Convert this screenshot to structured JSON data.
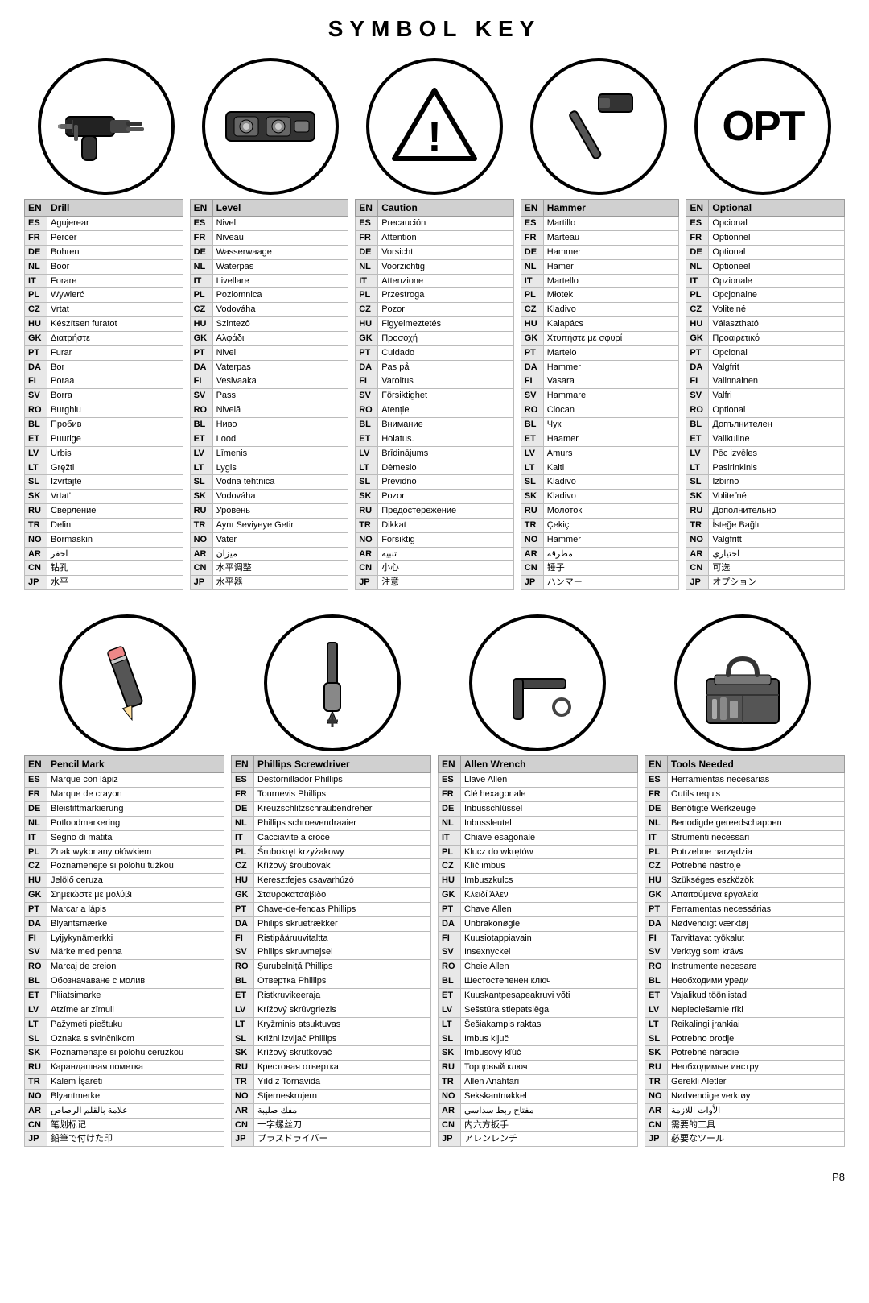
{
  "title": "SYMBOL KEY",
  "page": "P8",
  "top_icons": [
    {
      "name": "drill-icon",
      "label": "Drill"
    },
    {
      "name": "level-icon",
      "label": "Level"
    },
    {
      "name": "caution-icon",
      "label": "Caution"
    },
    {
      "name": "hammer-icon",
      "label": "Hammer"
    },
    {
      "name": "optional-icon",
      "label": "OPT"
    }
  ],
  "bottom_icons": [
    {
      "name": "pencil-icon",
      "label": "Pencil Mark"
    },
    {
      "name": "phillips-icon",
      "label": "Phillips Screwdriver"
    },
    {
      "name": "allen-icon",
      "label": "Allen Wrench"
    },
    {
      "name": "tools-icon",
      "label": "Tools Needed"
    }
  ],
  "tables": {
    "drill": {
      "header_code": "EN",
      "header_label": "Drill",
      "rows": [
        [
          "ES",
          "Agujerear"
        ],
        [
          "FR",
          "Percer"
        ],
        [
          "DE",
          "Bohren"
        ],
        [
          "NL",
          "Boor"
        ],
        [
          "IT",
          "Forare"
        ],
        [
          "PL",
          "Wywierć"
        ],
        [
          "CZ",
          "Vrtat"
        ],
        [
          "HU",
          "Készítsen furatot"
        ],
        [
          "GK",
          "Διατρήστε"
        ],
        [
          "PT",
          "Furar"
        ],
        [
          "DA",
          "Bor"
        ],
        [
          "FI",
          "Poraa"
        ],
        [
          "SV",
          "Borra"
        ],
        [
          "RO",
          "Burghiu"
        ],
        [
          "BL",
          "Пробив"
        ],
        [
          "ET",
          "Puurige"
        ],
        [
          "LV",
          "Urbis"
        ],
        [
          "LT",
          "Gręžti"
        ],
        [
          "SL",
          "Izvrtajte"
        ],
        [
          "SK",
          "Vrtat'"
        ],
        [
          "RU",
          "Сверление"
        ],
        [
          "TR",
          "Delin"
        ],
        [
          "NO",
          "Bormaskin"
        ],
        [
          "AR",
          "احفر"
        ],
        [
          "CN",
          "钻孔"
        ],
        [
          "JP",
          "水平"
        ]
      ]
    },
    "level": {
      "header_code": "EN",
      "header_label": "Level",
      "rows": [
        [
          "ES",
          "Nivel"
        ],
        [
          "FR",
          "Niveau"
        ],
        [
          "DE",
          "Wasserwaage"
        ],
        [
          "NL",
          "Waterpas"
        ],
        [
          "IT",
          "Livellare"
        ],
        [
          "PL",
          "Poziomnica"
        ],
        [
          "CZ",
          "Vodováha"
        ],
        [
          "HU",
          "Szintező"
        ],
        [
          "GK",
          "Αλφάδι"
        ],
        [
          "PT",
          "Nivel"
        ],
        [
          "DA",
          "Vaterpas"
        ],
        [
          "FI",
          "Vesivaaka"
        ],
        [
          "SV",
          "Pass"
        ],
        [
          "RO",
          "Nivelă"
        ],
        [
          "BL",
          "Ниво"
        ],
        [
          "ET",
          "Lood"
        ],
        [
          "LV",
          "Līmenis"
        ],
        [
          "LT",
          "Lygis"
        ],
        [
          "SL",
          "Vodna tehtnica"
        ],
        [
          "SK",
          "Vodováha"
        ],
        [
          "RU",
          "Уровень"
        ],
        [
          "TR",
          "Aynı Seviyeye Getir"
        ],
        [
          "NO",
          "Vater"
        ],
        [
          "AR",
          "ميزان"
        ],
        [
          "CN",
          "水平调整"
        ],
        [
          "JP",
          "水平器"
        ]
      ]
    },
    "caution": {
      "header_code": "EN",
      "header_label": "Caution",
      "rows": [
        [
          "ES",
          "Precaución"
        ],
        [
          "FR",
          "Attention"
        ],
        [
          "DE",
          "Vorsicht"
        ],
        [
          "NL",
          "Voorzichtig"
        ],
        [
          "IT",
          "Attenzione"
        ],
        [
          "PL",
          "Przestroga"
        ],
        [
          "CZ",
          "Pozor"
        ],
        [
          "HU",
          "Figyelmeztetés"
        ],
        [
          "GK",
          "Προσοχή"
        ],
        [
          "PT",
          "Cuidado"
        ],
        [
          "DA",
          "Pas på"
        ],
        [
          "FI",
          "Varoitus"
        ],
        [
          "SV",
          "Försiktighet"
        ],
        [
          "RO",
          "Atenție"
        ],
        [
          "BL",
          "Внимание"
        ],
        [
          "ET",
          "Hoiatus."
        ],
        [
          "LV",
          "Brīdinājums"
        ],
        [
          "LT",
          "Dėmesio"
        ],
        [
          "SL",
          "Previdno"
        ],
        [
          "SK",
          "Pozor"
        ],
        [
          "RU",
          "Предостережение"
        ],
        [
          "TR",
          "Dikkat"
        ],
        [
          "NO",
          "Forsiktig"
        ],
        [
          "AR",
          "تنبيه"
        ],
        [
          "CN",
          "小心"
        ],
        [
          "JP",
          "注意"
        ]
      ]
    },
    "hammer": {
      "header_code": "EN",
      "header_label": "Hammer",
      "rows": [
        [
          "ES",
          "Martillo"
        ],
        [
          "FR",
          "Marteau"
        ],
        [
          "DE",
          "Hammer"
        ],
        [
          "NL",
          "Hamer"
        ],
        [
          "IT",
          "Martello"
        ],
        [
          "PL",
          "Młotek"
        ],
        [
          "CZ",
          "Kladivo"
        ],
        [
          "HU",
          "Kalapács"
        ],
        [
          "GK",
          "Χτυπήστε με σφυρί"
        ],
        [
          "PT",
          "Martelo"
        ],
        [
          "DA",
          "Hammer"
        ],
        [
          "FI",
          "Vasara"
        ],
        [
          "SV",
          "Hammare"
        ],
        [
          "RO",
          "Ciocan"
        ],
        [
          "BL",
          "Чук"
        ],
        [
          "ET",
          "Haamer"
        ],
        [
          "LV",
          "Āmurs"
        ],
        [
          "LT",
          "Kalti"
        ],
        [
          "SL",
          "Kladivo"
        ],
        [
          "SK",
          "Kladivo"
        ],
        [
          "RU",
          "Молоток"
        ],
        [
          "TR",
          "Çekiç"
        ],
        [
          "NO",
          "Hammer"
        ],
        [
          "AR",
          "مطرقة"
        ],
        [
          "CN",
          "锤子"
        ],
        [
          "JP",
          "ハンマー"
        ]
      ]
    },
    "optional": {
      "header_code": "EN",
      "header_label": "Optional",
      "rows": [
        [
          "ES",
          "Opcional"
        ],
        [
          "FR",
          "Optionnel"
        ],
        [
          "DE",
          "Optional"
        ],
        [
          "NL",
          "Optioneel"
        ],
        [
          "IT",
          "Opzionale"
        ],
        [
          "PL",
          "Opcjonalne"
        ],
        [
          "CZ",
          "Volitelné"
        ],
        [
          "HU",
          "Választható"
        ],
        [
          "GK",
          "Προαιρετικό"
        ],
        [
          "PT",
          "Opcional"
        ],
        [
          "DA",
          "Valgfrit"
        ],
        [
          "FI",
          "Valinnainen"
        ],
        [
          "SV",
          "Valfri"
        ],
        [
          "RO",
          "Optional"
        ],
        [
          "BL",
          "Допълнителен"
        ],
        [
          "ET",
          "Valikuline"
        ],
        [
          "LV",
          "Pēc izvēles"
        ],
        [
          "LT",
          "Pasirinkinis"
        ],
        [
          "SL",
          "Izbirno"
        ],
        [
          "SK",
          "Voliteľné"
        ],
        [
          "RU",
          "Дополнительно"
        ],
        [
          "TR",
          "İsteğe Bağlı"
        ],
        [
          "NO",
          "Valgfritt"
        ],
        [
          "AR",
          "اختياري"
        ],
        [
          "CN",
          "可选"
        ],
        [
          "JP",
          "オプション"
        ]
      ]
    },
    "pencil": {
      "header_code": "EN",
      "header_label": "Pencil Mark",
      "rows": [
        [
          "ES",
          "Marque con lápiz"
        ],
        [
          "FR",
          "Marque de crayon"
        ],
        [
          "DE",
          "Bleistiftmarkierung"
        ],
        [
          "NL",
          "Potloodmarkering"
        ],
        [
          "IT",
          "Segno di matita"
        ],
        [
          "PL",
          "Znak wykonany ołówkiem"
        ],
        [
          "CZ",
          "Poznamenejte si polohu tužkou"
        ],
        [
          "HU",
          "Jelölő ceruza"
        ],
        [
          "GK",
          "Σημειώστε με μολύβι"
        ],
        [
          "PT",
          "Marcar a lápis"
        ],
        [
          "DA",
          "Blyantsmærke"
        ],
        [
          "FI",
          "Lyijykynämerkki"
        ],
        [
          "SV",
          "Märke med penna"
        ],
        [
          "RO",
          "Marcaj de creion"
        ],
        [
          "BL",
          "Обозначаване с молив"
        ],
        [
          "ET",
          "Pliiatsimarке"
        ],
        [
          "LV",
          "Atzīme ar zīmuli"
        ],
        [
          "LT",
          "Pažymėti pieštuku"
        ],
        [
          "SL",
          "Oznaka s svinčnikom"
        ],
        [
          "SK",
          "Poznamenajte si polohu ceruzkou"
        ],
        [
          "RU",
          "Карандашная пометка"
        ],
        [
          "TR",
          "Kalem İşareti"
        ],
        [
          "NO",
          "Blyantmerke"
        ],
        [
          "AR",
          "علامة بالقلم الرصاص"
        ],
        [
          "CN",
          "笔划标记"
        ],
        [
          "JP",
          "鉛筆で付けた印"
        ]
      ]
    },
    "phillips": {
      "header_code": "EN",
      "header_label": "Phillips Screwdriver",
      "rows": [
        [
          "ES",
          "Destornillador Phillips"
        ],
        [
          "FR",
          "Tournevis Phillips"
        ],
        [
          "DE",
          "Kreuzschlitzschraubendreher"
        ],
        [
          "NL",
          "Phillips schroevendraaier"
        ],
        [
          "IT",
          "Cacciavite a croce"
        ],
        [
          "PL",
          "Śrubokręt krzyżakowy"
        ],
        [
          "CZ",
          "Křížový šroubovák"
        ],
        [
          "HU",
          "Keresztfejes csavarhúzó"
        ],
        [
          "GK",
          "Σταυροκατσάβιδο"
        ],
        [
          "PT",
          "Chave-de-fendas Phillips"
        ],
        [
          "DA",
          "Philips skruetrækker"
        ],
        [
          "FI",
          "Ristipääruuvitaltta"
        ],
        [
          "SV",
          "Philips skruvmejsel"
        ],
        [
          "RO",
          "Șurubelniță Phillips"
        ],
        [
          "BL",
          "Отвертка Phillips"
        ],
        [
          "ET",
          "Ristkruvikeeraja"
        ],
        [
          "LV",
          "Krížový skrúvgriezis"
        ],
        [
          "LT",
          "Kryžminis atsuktuvas"
        ],
        [
          "SL",
          "Križni izvijač Phillips"
        ],
        [
          "SK",
          "Krížový skrutkovač"
        ],
        [
          "RU",
          "Крестовая отвертка"
        ],
        [
          "TR",
          "Yıldız Tornavida"
        ],
        [
          "NO",
          "Stjerneskrujern"
        ],
        [
          "AR",
          "مفك صليبة"
        ],
        [
          "CN",
          "十字螺丝刀"
        ],
        [
          "JP",
          "プラスドライバー"
        ]
      ]
    },
    "allen": {
      "header_code": "EN",
      "header_label": "Allen Wrench",
      "rows": [
        [
          "ES",
          "Llave Allen"
        ],
        [
          "FR",
          "Clé hexagonale"
        ],
        [
          "DE",
          "Inbusschlüssel"
        ],
        [
          "NL",
          "Inbussleutel"
        ],
        [
          "IT",
          "Chiave esagonale"
        ],
        [
          "PL",
          "Klucz do wkrętów"
        ],
        [
          "CZ",
          "Klíč imbus"
        ],
        [
          "HU",
          "Imbuszkulcs"
        ],
        [
          "GK",
          "Κλειδί Άλεν"
        ],
        [
          "PT",
          "Chave Allen"
        ],
        [
          "DA",
          "Unbrakonøgle"
        ],
        [
          "FI",
          "Kuusiotappiavain"
        ],
        [
          "SV",
          "Insexnyckel"
        ],
        [
          "RO",
          "Cheie Allen"
        ],
        [
          "BL",
          "Шестостепенен ключ"
        ],
        [
          "ET",
          "Kuuskantpesapeakruvi võti"
        ],
        [
          "LV",
          "Sešstūra stiepatslēga"
        ],
        [
          "LT",
          "Šešiakampis raktas"
        ],
        [
          "SL",
          "Imbus ključ"
        ],
        [
          "SK",
          "Imbusový kľúč"
        ],
        [
          "RU",
          "Торцовый ключ"
        ],
        [
          "TR",
          "Allen Anahtarı"
        ],
        [
          "NO",
          "Sekskantnøkkel"
        ],
        [
          "AR",
          "مفتاح ربط سداسي"
        ],
        [
          "CN",
          "内六方扳手"
        ],
        [
          "JP",
          "アレンレンチ"
        ]
      ]
    },
    "tools": {
      "header_code": "EN",
      "header_label": "Tools Needed",
      "rows": [
        [
          "ES",
          "Herramientas necesarias"
        ],
        [
          "FR",
          "Outils requis"
        ],
        [
          "DE",
          "Benötigte Werkzeuge"
        ],
        [
          "NL",
          "Benodigde gereedschappen"
        ],
        [
          "IT",
          "Strumenti necessari"
        ],
        [
          "PL",
          "Potrzebne narzędzia"
        ],
        [
          "CZ",
          "Potřebné nástroje"
        ],
        [
          "HU",
          "Szükséges eszközök"
        ],
        [
          "GK",
          "Απαιτούμενα εργαλεία"
        ],
        [
          "PT",
          "Ferramentas necessárias"
        ],
        [
          "DA",
          "Nødvendigt værktøj"
        ],
        [
          "FI",
          "Tarvittavat työkalut"
        ],
        [
          "SV",
          "Verktyg som krävs"
        ],
        [
          "RO",
          "Instrumente necesare"
        ],
        [
          "BL",
          "Необходими уреди"
        ],
        [
          "ET",
          "Vajalikud tööniistad"
        ],
        [
          "LV",
          "Nepieciešamie rīki"
        ],
        [
          "LT",
          "Reikalingi įrankiai"
        ],
        [
          "SL",
          "Potrebno orodje"
        ],
        [
          "SK",
          "Potrebné náradie"
        ],
        [
          "RU",
          "Необходимые инстру"
        ],
        [
          "TR",
          "Gerekli Aletler"
        ],
        [
          "NO",
          "Nødvendige verktøy"
        ],
        [
          "AR",
          "الأوات اللازمة"
        ],
        [
          "CN",
          "需要的工具"
        ],
        [
          "JP",
          "必要なツール"
        ]
      ]
    }
  }
}
